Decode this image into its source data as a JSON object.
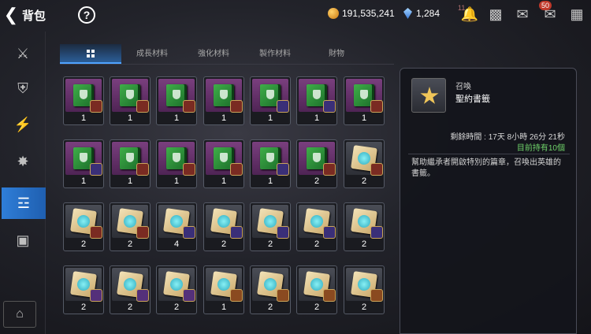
{
  "header": {
    "back_icon": "chevron-left-icon",
    "title": "背包",
    "help_icon": "help-circle-icon",
    "gold": "191,535,241",
    "gems": "1,284",
    "bell_badge": "11",
    "chat_badge": "50"
  },
  "sidebar": {
    "items": [
      "sword-lock-icon",
      "shield-off-icon",
      "lightning-icon",
      "burst-icon",
      "backpack-icon",
      "chest-icon"
    ],
    "active_index": 4,
    "bottom_icon": "warehouse-icon"
  },
  "tabs": [
    "",
    "成長材料",
    "強化材料",
    "製作材料",
    "財物"
  ],
  "active_tab": 0,
  "items": [
    {
      "art": "book",
      "bg": "purple",
      "rank": "red",
      "count": "1"
    },
    {
      "art": "book",
      "bg": "purple",
      "rank": "red",
      "count": "1"
    },
    {
      "art": "book",
      "bg": "purple",
      "rank": "red",
      "count": "1"
    },
    {
      "art": "book",
      "bg": "purple",
      "rank": "red",
      "count": "1"
    },
    {
      "art": "book",
      "bg": "purple",
      "rank": "gold",
      "count": "1"
    },
    {
      "art": "book",
      "bg": "purple",
      "rank": "gold",
      "count": "1"
    },
    {
      "art": "book",
      "bg": "purple",
      "rank": "red",
      "count": "1"
    },
    {
      "art": "book",
      "bg": "purple",
      "rank": "gold",
      "count": "1"
    },
    {
      "art": "book",
      "bg": "purple",
      "rank": "red",
      "count": "1"
    },
    {
      "art": "book",
      "bg": "purple",
      "rank": "red",
      "count": "1"
    },
    {
      "art": "book",
      "bg": "purple",
      "rank": "red",
      "count": "1"
    },
    {
      "art": "book",
      "bg": "purple",
      "rank": "gold",
      "count": "1"
    },
    {
      "art": "book",
      "bg": "purple",
      "rank": "red",
      "count": "2"
    },
    {
      "art": "scroll",
      "bg": "grey",
      "rank": "red",
      "count": "2"
    },
    {
      "art": "scroll",
      "bg": "grey",
      "rank": "red",
      "count": "2"
    },
    {
      "art": "scroll",
      "bg": "grey",
      "rank": "red",
      "count": "2"
    },
    {
      "art": "scroll",
      "bg": "grey",
      "rank": "gold",
      "count": "4"
    },
    {
      "art": "scroll",
      "bg": "grey",
      "rank": "gold",
      "count": "2"
    },
    {
      "art": "scroll",
      "bg": "grey",
      "rank": "gold",
      "count": "2"
    },
    {
      "art": "scroll",
      "bg": "grey",
      "rank": "gold",
      "count": "2"
    },
    {
      "art": "scroll",
      "bg": "grey",
      "rank": "gold",
      "count": "2"
    },
    {
      "art": "scroll",
      "bg": "grey",
      "rank": "purple",
      "count": "2"
    },
    {
      "art": "scroll",
      "bg": "grey",
      "rank": "purple",
      "count": "2"
    },
    {
      "art": "scroll",
      "bg": "grey",
      "rank": "purple",
      "count": "2"
    },
    {
      "art": "scroll",
      "bg": "grey",
      "rank": "bronze",
      "count": "1"
    },
    {
      "art": "scroll",
      "bg": "grey",
      "rank": "bronze",
      "count": "2"
    },
    {
      "art": "scroll",
      "bg": "grey",
      "rank": "bronze",
      "count": "2"
    },
    {
      "art": "scroll",
      "bg": "grey",
      "rank": "bronze",
      "count": "2"
    }
  ],
  "detail": {
    "type": "召喚",
    "name": "聖約書籤",
    "timer": "剩餘時間 : 17天 8小時 26分 21秒",
    "owned": "目前持有10個",
    "description": "幫助繼承者開啟特別的篇章，召喚出英雄的書籤。"
  }
}
